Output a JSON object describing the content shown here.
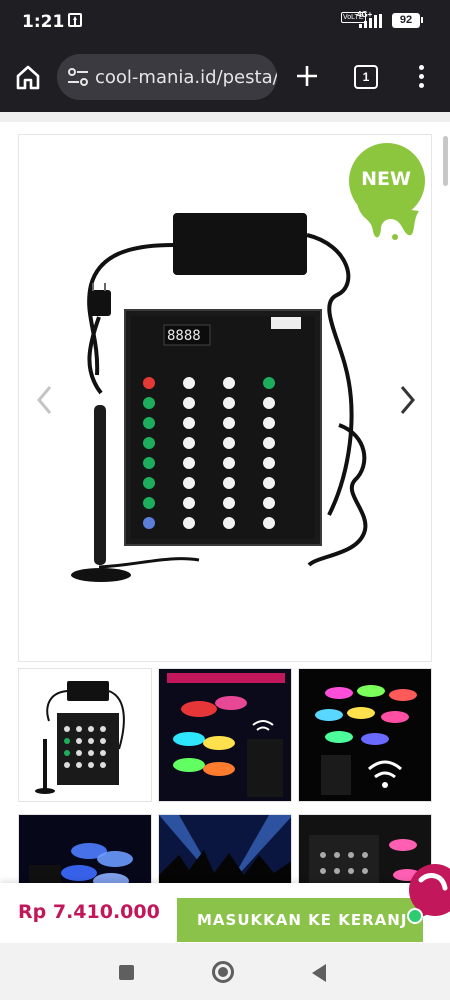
{
  "status_bar": {
    "time": "1:21",
    "volte": "VoLTE",
    "network": "4G+",
    "battery": "92",
    "upload_icon": "upload-icon"
  },
  "browser": {
    "url": "cool-mania.id/pesta/",
    "tab_count": "1",
    "icons": [
      "home-icon",
      "site-info-icon",
      "new-tab-icon",
      "tabs-icon",
      "menu-icon"
    ]
  },
  "product": {
    "badge": "NEW",
    "badge_color": "#8cc63f",
    "main_image": "wireless-led-wristband-controller",
    "thumbnails": [
      "controller-kit",
      "led-wristbands-with-remote",
      "glowing-wristbands-wifi",
      "blue-wristbands-controller",
      "concert-crowd",
      "controller-with-pink-bands"
    ],
    "price": "Rp 7.410.000",
    "price_color": "#c2185b",
    "add_to_cart_label": "MASUKKAN KE KERANJ",
    "cart_color": "#8bc34a",
    "chat_icon": "chat-bubble-icon"
  },
  "nav": {
    "icons": [
      "recents-icon",
      "home-circle-icon",
      "back-icon"
    ]
  }
}
